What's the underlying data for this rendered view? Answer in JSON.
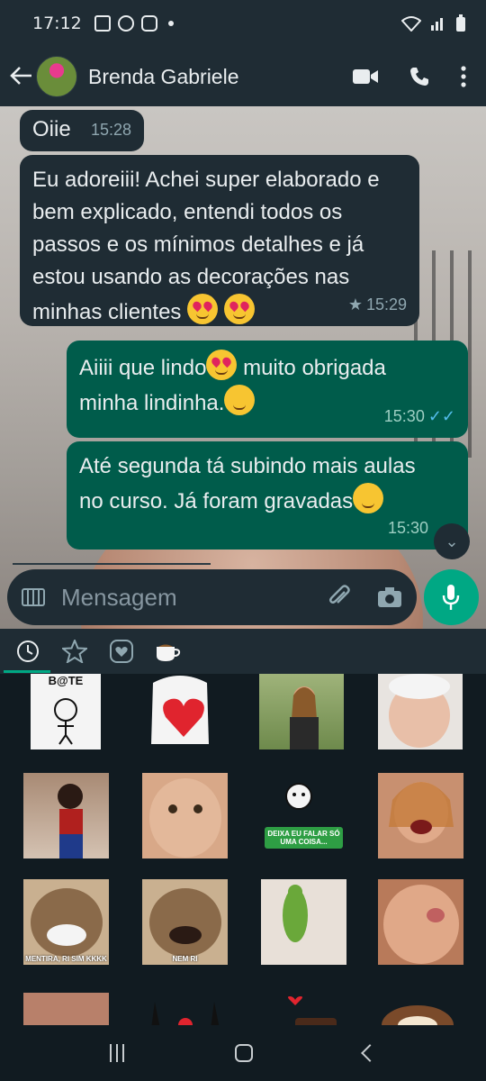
{
  "status_bar": {
    "time": "17:12"
  },
  "header": {
    "contact_name": "Brenda Gabriele"
  },
  "messages": [
    {
      "direction": "in",
      "text": "Oiie",
      "time": "15:28"
    },
    {
      "direction": "in",
      "text": "Eu adoreiii! Achei super elaborado e bem explicado, entendi todos os passos e os mínimos detalhes e já estou usando as decorações nas minhas clientes",
      "time": "15:29",
      "starred": true
    },
    {
      "direction": "out",
      "text_line1": "Aiiii que lindo",
      "text_line1_after": " muito obrigada",
      "text_line2": "minha lindinha.",
      "time": "15:30",
      "ticks": "read"
    },
    {
      "direction": "out",
      "text_line1": "Até segunda tá subindo mais aulas",
      "text_line2": "no curso. Já foram gravadas",
      "time": "15:30"
    }
  ],
  "composer": {
    "placeholder": "Mensagem"
  },
  "sticker_panel": {
    "tabs": [
      "recent-icon",
      "star-icon",
      "heart-icon",
      "coffee-icon"
    ],
    "stickers": [
      {
        "caption": "B@TE"
      },
      {
        "caption": ""
      },
      {
        "caption": ""
      },
      {
        "caption": ""
      },
      {
        "caption": ""
      },
      {
        "caption": ""
      },
      {
        "caption": "DEIXA EU FALAR SÓ UMA COISA..."
      },
      {
        "caption": ""
      },
      {
        "caption": "MENTIRA, RI SIM KKKK"
      },
      {
        "caption": "NEM RI"
      },
      {
        "caption": ""
      },
      {
        "caption": ""
      }
    ]
  },
  "colors": {
    "accent": "#00a884",
    "outgoing_bubble": "#005c4b",
    "incoming_bubble": "#1f2c34",
    "read_ticks": "#53bdeb"
  }
}
